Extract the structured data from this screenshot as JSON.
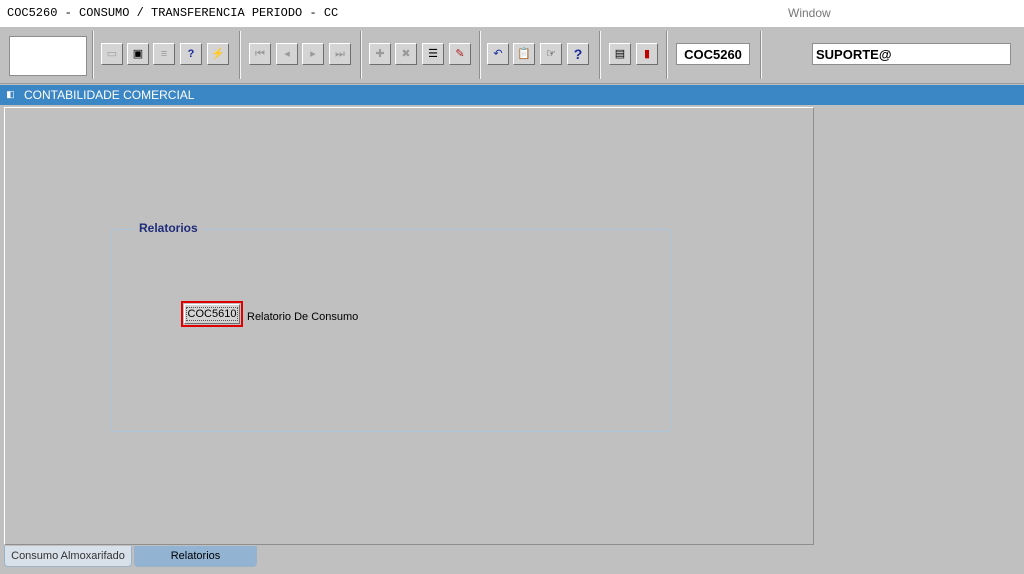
{
  "window": {
    "title": "COC5260 - CONSUMO / TRANSFERENCIA PERIODO - CC",
    "menu_window": "Window"
  },
  "toolbar": {
    "buttons": {
      "save": {
        "icon": "save-icon",
        "glyph": "▭"
      },
      "print_setup": {
        "icon": "window-icon",
        "glyph": "▣"
      },
      "print": {
        "icon": "print-icon",
        "glyph": "≡"
      },
      "query": {
        "icon": "query-help-icon",
        "glyph": "?"
      },
      "execute_query": {
        "icon": "execute-query-icon",
        "glyph": "⚡"
      },
      "first": {
        "icon": "first-record-icon",
        "glyph": "⏮"
      },
      "prev": {
        "icon": "previous-record-icon",
        "glyph": "◂"
      },
      "next": {
        "icon": "next-record-icon",
        "glyph": "▸"
      },
      "last": {
        "icon": "last-record-icon",
        "glyph": "⏭"
      },
      "insert": {
        "icon": "insert-record-icon",
        "glyph": "✚"
      },
      "delete": {
        "icon": "delete-record-icon",
        "glyph": "✖"
      },
      "list_values": {
        "icon": "list-values-icon",
        "glyph": "☰"
      },
      "edit": {
        "icon": "edit-pencil-icon",
        "glyph": "✎"
      },
      "undo": {
        "icon": "undo-icon",
        "glyph": "↶"
      },
      "clipboard": {
        "icon": "clipboard-icon",
        "glyph": "📋"
      },
      "pointer": {
        "icon": "pointer-icon",
        "glyph": "☞"
      },
      "help": {
        "icon": "help-icon",
        "glyph": "?"
      },
      "menu": {
        "icon": "menu-icon",
        "glyph": "▤"
      },
      "exit": {
        "icon": "exit-door-icon",
        "glyph": "▮"
      }
    },
    "form_code": "COC5260",
    "user": "SUPORTE@"
  },
  "header": {
    "title": "CONTABILIDADE COMERCIAL",
    "icon": "module-icon"
  },
  "relatorios": {
    "frame_title": "Relatorios",
    "items": [
      {
        "button_label": "COC5610",
        "description": "Relatorio De Consumo"
      }
    ]
  },
  "tabs": [
    {
      "label": "Consumo Almoxarifado",
      "active": false
    },
    {
      "label": "Relatorios",
      "active": true
    }
  ],
  "colors": {
    "header_bg": "#3b86c4",
    "highlight_outline": "#e00000",
    "frame_title": "#1f2d7a",
    "active_tab": "#93b3d3"
  }
}
